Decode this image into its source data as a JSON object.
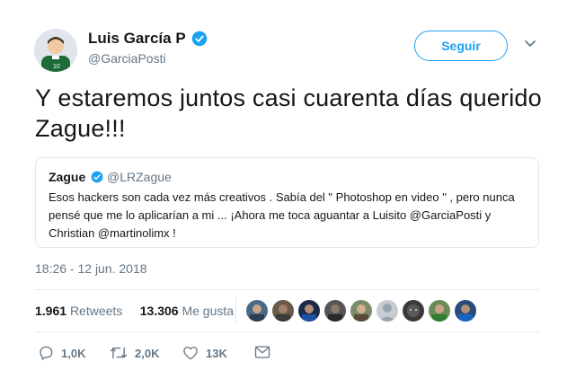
{
  "header": {
    "name": "Luis García P",
    "handle": "@GarciaPosti",
    "follow_label": "Seguir"
  },
  "tweet": {
    "text": "Y estaremos juntos casi cuarenta días querido Zague!!!"
  },
  "quoted": {
    "name": "Zague",
    "handle": "@LRZague",
    "text": "Esos hackers son cada vez más creativos . Sabía del \" Photoshop en video \" , pero nunca pensé que me lo aplicarían a mi ... ¡Ahora me toca aguantar a Luisito @GarciaPosti y Christian @martinolimx !"
  },
  "timestamp": "18:26 - 12 jun. 2018",
  "stats": {
    "retweets_count": "1.961",
    "retweets_label": "Retweets",
    "likes_count": "13.306",
    "likes_label": "Me gusta"
  },
  "actions": {
    "reply_count": "1,0K",
    "retweet_count": "2,0K",
    "like_count": "13K"
  },
  "colors": {
    "accent": "#1da1f2",
    "secondary_text": "#657786"
  }
}
